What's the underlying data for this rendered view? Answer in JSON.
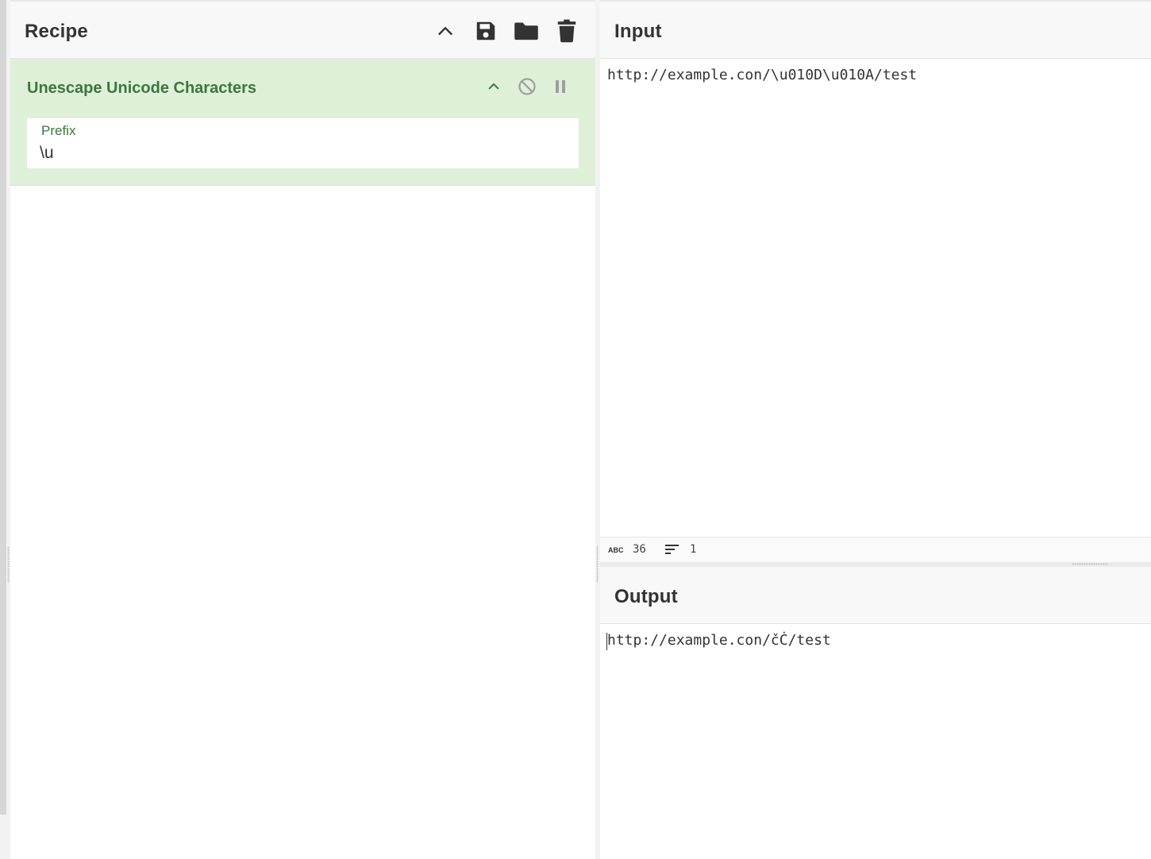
{
  "recipe": {
    "title": "Recipe",
    "actions": [
      {
        "name": "collapse",
        "icon": "chevron-up-icon"
      },
      {
        "name": "save",
        "icon": "floppy-disk-icon"
      },
      {
        "name": "load",
        "icon": "folder-icon"
      },
      {
        "name": "clear",
        "icon": "trash-icon"
      }
    ],
    "operation": {
      "title": "Unescape Unicode Characters",
      "controls": [
        "chevron-up-icon",
        "disable-icon",
        "pause-icon"
      ],
      "field": {
        "label": "Prefix",
        "value": "\\u"
      }
    }
  },
  "input": {
    "title": "Input",
    "text": "http://example.con/\\u010D\\u010A/test",
    "stats": {
      "chars": "36",
      "lines": "1"
    }
  },
  "output": {
    "title": "Output",
    "text": "http://example.con/čĊ/test"
  },
  "colors": {
    "accent_green": "#3c763d",
    "operation_bg": "#dff0d8",
    "header_bg": "#f8f8f8"
  }
}
